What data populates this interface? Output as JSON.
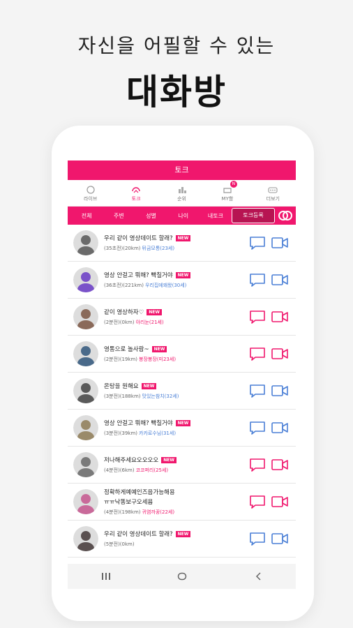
{
  "headline": {
    "line1": "자신을 어필할 수 있는",
    "line2": "대화방"
  },
  "topbar": {
    "title": "토크"
  },
  "tabs": [
    {
      "label": "라이브",
      "icon": "live-icon"
    },
    {
      "label": "토크",
      "icon": "talk-icon",
      "active": true
    },
    {
      "label": "순위",
      "icon": "ranking-icon"
    },
    {
      "label": "MY함",
      "icon": "inbox-icon",
      "badge": "N"
    },
    {
      "label": "더보기",
      "icon": "more-icon"
    }
  ],
  "subtabs": [
    "전체",
    "주변",
    "성별",
    "나이",
    "내토크"
  ],
  "register_label": "토크등록",
  "colors": {
    "accent": "#f0176d",
    "male": "#4a7fd6",
    "female": "#f0176d"
  },
  "rows": [
    {
      "msg": "우리 같이 영상데이트 할래?",
      "new": "NEW",
      "time": "(35초전)",
      "dist": "(20km)",
      "nick": "뒤금모통(23세)",
      "gender": "male"
    },
    {
      "msg": "영상 안걸고 뭐해? 빡칠거야",
      "new": "NEW",
      "time": "(36초전)",
      "dist": "(221km)",
      "nick": "우리집에왜왔(30세)",
      "gender": "male"
    },
    {
      "msg": "같이 영상하자♡",
      "new": "NEW",
      "time": "(2분전)",
      "dist": "(0km)",
      "nick": "아리눈(21세)",
      "gender": "female"
    },
    {
      "msg": "영통으로 놀사람~",
      "new": "NEW",
      "time": "(2분전)",
      "dist": "(19km)",
      "nick": "봉장봉장(미23세)",
      "gender": "female"
    },
    {
      "msg": "온탕을 원해요",
      "new": "NEW",
      "time": "(3분전)",
      "dist": "(188km)",
      "nick": "맛있는참치(32세)",
      "gender": "male"
    },
    {
      "msg": "영상 안걸고 뭐해? 빡칠거야",
      "new": "NEW",
      "time": "(3분전)",
      "dist": "(39km)",
      "nick": "카카로수님(31세)",
      "gender": "male"
    },
    {
      "msg": "저나해주세요오오오오",
      "new": "NEW",
      "time": "(4분전)",
      "dist": "(6km)",
      "nick": "코코퍼리(25세)",
      "gender": "female"
    },
    {
      "msg": "정확하게예예인즈음가능해용",
      "msg2": "ㅠㅠ낙똥보구오세욤",
      "time": "(4분전)",
      "dist": "(198km)",
      "nick": "귀염까꿍(22세)",
      "gender": "female"
    },
    {
      "msg": "우리 같이 영상데이트 할래?",
      "new": "NEW",
      "time": "(5분전)",
      "dist": "(0km)",
      "nick": "",
      "gender": "male"
    }
  ]
}
